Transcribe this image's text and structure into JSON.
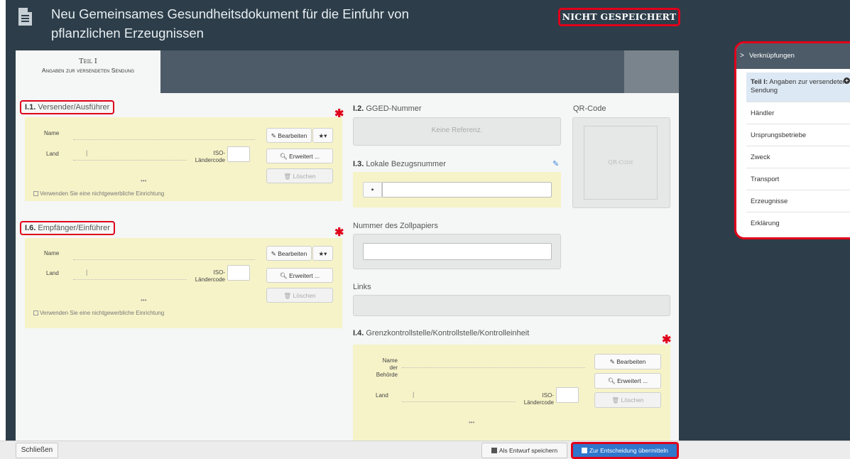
{
  "header": {
    "title": "Neu Gemeinsames Gesundheitsdokument für die Einfuhr von pflanzlichen Erzeugnissen",
    "status": "NICHT GESPEICHERT"
  },
  "tabs": [
    {
      "label": "Teil I",
      "sublabel": "Angaben zur versendeten Sendung"
    }
  ],
  "consignor": {
    "code": "I.1.",
    "title": "Versender/Ausführer",
    "name_label": "Name",
    "country_label": "Land",
    "iso_label_1": "ISO-",
    "iso_label_2": "Ländercode",
    "edit_label": "Bearbeiten",
    "advanced_label": "Erweitert ...",
    "delete_label": "Löschen",
    "ellipsis": "•••",
    "noncommercial_label": "Verwenden Sie eine nichtgewerbliche Einrichtung"
  },
  "consignee": {
    "code": "I.6.",
    "title": "Empfänger/Einführer",
    "name_label": "Name",
    "country_label": "Land",
    "iso_label_1": "ISO-",
    "iso_label_2": "Ländercode",
    "edit_label": "Bearbeiten",
    "advanced_label": "Erweitert ...",
    "delete_label": "Löschen",
    "ellipsis": "•••",
    "noncommercial_label": "Verwenden Sie eine nichtgewerbliche Einrichtung"
  },
  "gged": {
    "code": "I.2.",
    "title": "GGED-Nummer",
    "value": "Keine Referenz."
  },
  "qr": {
    "title": "QR-Code",
    "placeholder": "QR-Code"
  },
  "local_ref": {
    "code": "I.3.",
    "title": "Lokale Bezugsnummer",
    "value": ""
  },
  "customs": {
    "title": "Nummer des Zollpapiers",
    "value": ""
  },
  "links": {
    "title": "Links"
  },
  "bcp": {
    "code": "I.4.",
    "title": "Grenzkontrollstelle/Kontrollstelle/Kontrolleinheit",
    "name_label_1": "Name",
    "name_label_2": "der",
    "name_label_3": "Behörde",
    "country_label": "Land",
    "iso_label_1": "ISO-",
    "iso_label_2": "Ländercode",
    "edit_label": "Bearbeiten",
    "advanced_label": "Erweitert ...",
    "delete_label": "Löschen",
    "ellipsis": "•••"
  },
  "sidebar": {
    "title": "Verknüpfungen",
    "items": [
      {
        "bold": "Teil I:",
        "label": "Angaben zur versendeten Sendung"
      },
      {
        "label": "Händler"
      },
      {
        "label": "Ursprungsbetriebe"
      },
      {
        "label": "Zweck"
      },
      {
        "label": "Transport"
      },
      {
        "label": "Erzeugnisse"
      },
      {
        "label": "Erklärung"
      }
    ]
  },
  "footer": {
    "close_label": "Schließen",
    "draft_label": "Als Entwurf speichern",
    "submit_label": "Zur Entscheidung übermitteln"
  },
  "colors": {
    "dark_bg": "#2d3e4a",
    "highlight_red": "#e0001a",
    "section_yellow": "#f6f3c8",
    "primary_blue": "#2f76cc"
  }
}
